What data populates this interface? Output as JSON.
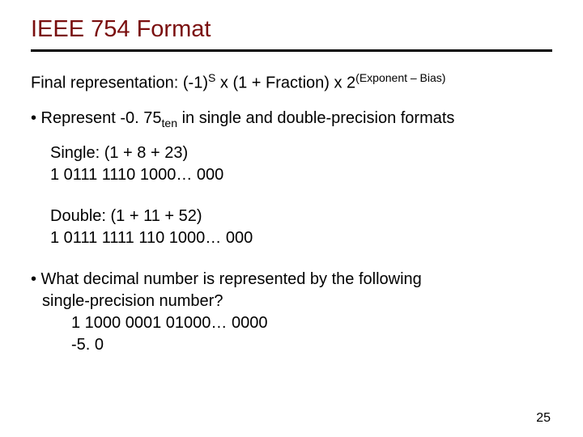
{
  "title": "IEEE 754 Format",
  "repr_prefix": "Final representation: (-1)",
  "repr_sup1": "S",
  "repr_mid": " x (1 + Fraction) x 2",
  "repr_sup2": "(Exponent – Bias)",
  "bullet1_a": "• Represent  -0. 75",
  "bullet1_sub": "ten",
  "bullet1_b": " in single and double-precision formats",
  "single_label": "Single:  (1 + 8 + 23)",
  "single_bits": "1   0111 1110   1000… 000",
  "double_label": "Double: (1 + 11 + 52)",
  "double_bits": "1   0111 1111  110    1000… 000",
  "bullet2_l1": "• What decimal number is represented by the following",
  "bullet2_l2": "  single-precision number?",
  "bullet2_bits": "1   1000 0001    01000… 0000",
  "bullet2_ans": "-5. 0",
  "pagenum": "25"
}
